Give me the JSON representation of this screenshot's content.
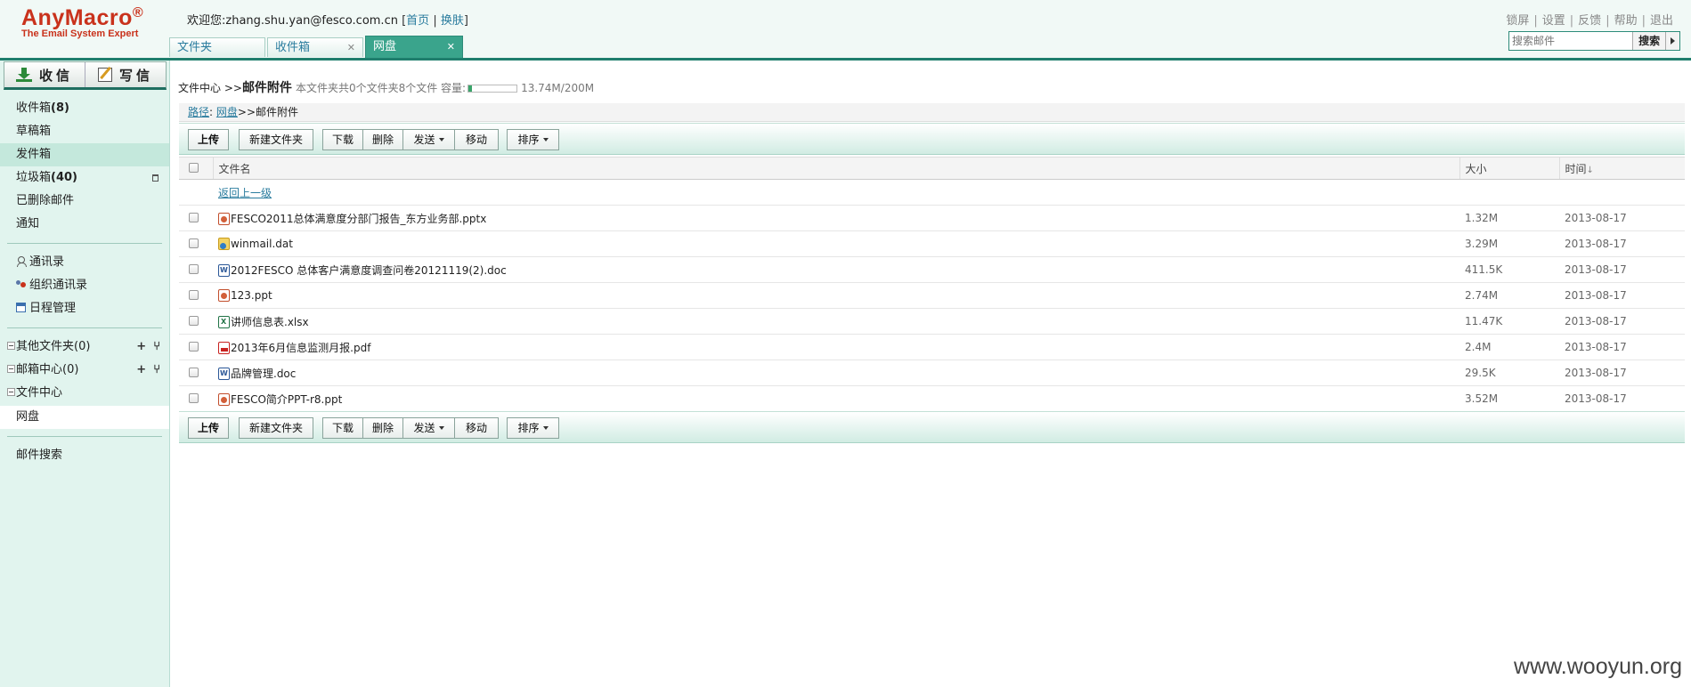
{
  "logo": {
    "brand": "AnyMacro",
    "reg": "®",
    "tagline": "The Email System Expert"
  },
  "header": {
    "welcome_prefix": "欢迎您:zhang.shu.yan@fesco.com.cn",
    "home_link": "首页",
    "switch_link": "换肤",
    "top_links": [
      "锁屏",
      "设置",
      "反馈",
      "帮助",
      "退出"
    ],
    "search_placeholder": "搜索邮件",
    "search_button": "搜索"
  },
  "tabs": [
    {
      "label": "文件夹",
      "closable": false,
      "active": false
    },
    {
      "label": "收件箱",
      "closable": true,
      "active": false
    },
    {
      "label": "网盘",
      "closable": true,
      "active": true
    }
  ],
  "sidebar": {
    "receive_label": "收信",
    "compose_label": "写信",
    "folders": [
      {
        "label": "收件箱",
        "count": "(8)"
      },
      {
        "label": "草稿箱",
        "count": ""
      },
      {
        "label": "发件箱",
        "count": ""
      },
      {
        "label": "垃圾箱",
        "count": "(40)"
      },
      {
        "label": "已删除邮件",
        "count": ""
      },
      {
        "label": "通知",
        "count": ""
      }
    ],
    "tools": [
      "通讯录",
      "组织通讯录",
      "日程管理"
    ],
    "trees": [
      {
        "label": "其他文件夹(0)"
      },
      {
        "label": "邮箱中心(0)"
      },
      {
        "label": "文件中心"
      }
    ],
    "netdisk_label": "网盘",
    "search_label": "邮件搜索"
  },
  "main": {
    "crumb_prefix": "文件中心 >>",
    "crumb_current": "邮件附件",
    "folder_info": "本文件夹共0个文件夹8个文件 容量:",
    "usage_text": "13.74M/200M",
    "usage_fraction": 0.0687,
    "path_label": "路径",
    "path_root": "网盘",
    "path_rest": ">>邮件附件",
    "toolbar": {
      "upload": "上传",
      "new_folder": "新建文件夹",
      "download": "下载",
      "delete": "删除",
      "send": "发送",
      "move": "移动",
      "sort": "排序"
    },
    "columns": {
      "name": "文件名",
      "size": "大小",
      "time": "时间"
    },
    "back_link": "返回上一级",
    "files": [
      {
        "name": "FESCO2011总体满意度分部门报告_东方业务部.pptx",
        "size": "1.32M",
        "time": "2013-08-17",
        "icon": "ppt"
      },
      {
        "name": "winmail.dat",
        "size": "3.29M",
        "time": "2013-08-17",
        "icon": "dat"
      },
      {
        "name": "2012FESCO 总体客户满意度调查问卷20121119(2).doc",
        "size": "411.5K",
        "time": "2013-08-17",
        "icon": "doc"
      },
      {
        "name": "123.ppt",
        "size": "2.74M",
        "time": "2013-08-17",
        "icon": "ppt"
      },
      {
        "name": "讲师信息表.xlsx",
        "size": "11.47K",
        "time": "2013-08-17",
        "icon": "xls"
      },
      {
        "name": "2013年6月信息监测月报.pdf",
        "size": "2.4M",
        "time": "2013-08-17",
        "icon": "pdf"
      },
      {
        "name": "品牌管理.doc",
        "size": "29.5K",
        "time": "2013-08-17",
        "icon": "doc"
      },
      {
        "name": "FESCO简介PPT-r8.ppt",
        "size": "3.52M",
        "time": "2013-08-17",
        "icon": "ppt"
      }
    ]
  },
  "watermark": "www.wooyun.org"
}
